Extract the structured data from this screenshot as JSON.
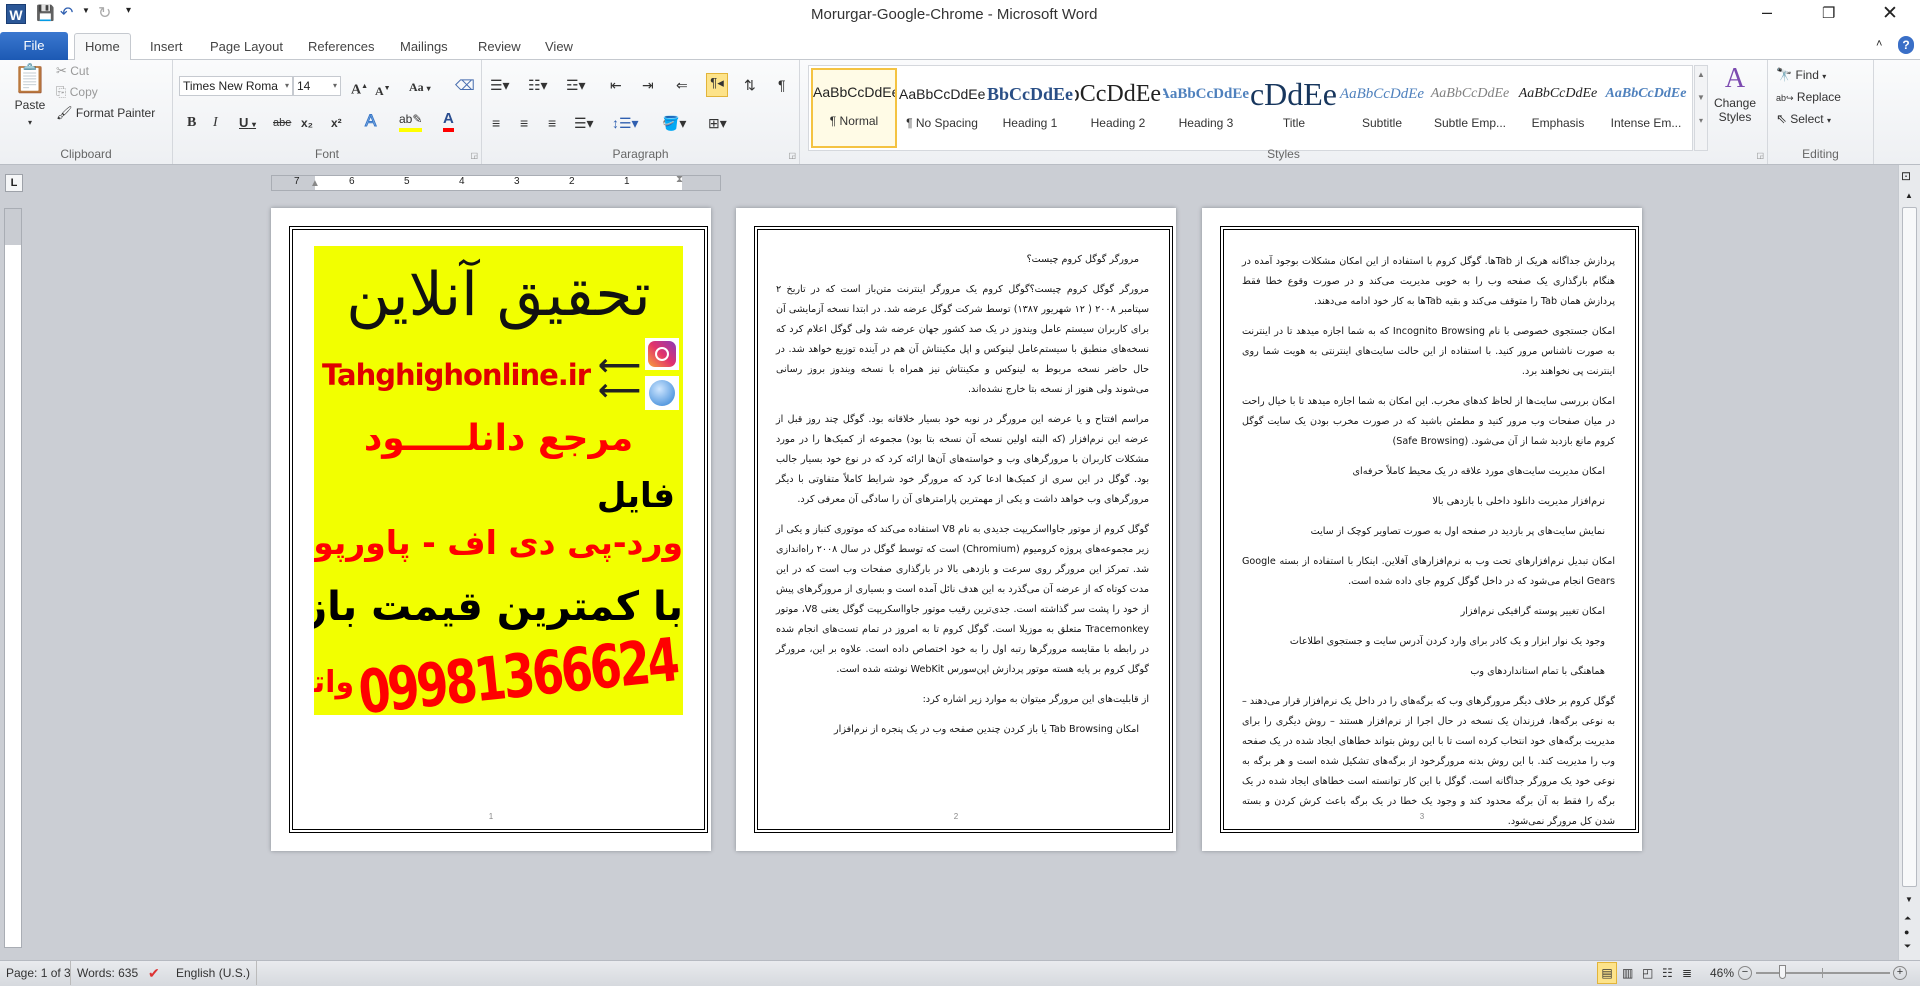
{
  "window": {
    "title": "Morurgar-Google-Chrome  -  Microsoft Word"
  },
  "qat": {
    "icons": [
      "word-logo",
      "save",
      "undo",
      "redo",
      "customize"
    ]
  },
  "tabs": {
    "file": "File",
    "items": [
      "Home",
      "Insert",
      "Page Layout",
      "References",
      "Mailings",
      "Review",
      "View"
    ],
    "selected": "Home"
  },
  "clipboard": {
    "label": "Clipboard",
    "paste": "Paste",
    "cut": "Cut",
    "copy": "Copy",
    "format_painter": "Format Painter"
  },
  "font": {
    "label": "Font",
    "name": "Times New Roma",
    "size": "14",
    "bold": "B",
    "italic": "I",
    "underline": "U",
    "strike": "abe",
    "sub": "x₂",
    "sup": "x²",
    "change_case": "Aa",
    "highlight_color": "#ffff00",
    "font_color": "#ff0000"
  },
  "paragraph": {
    "label": "Paragraph",
    "pilcrow": "¶"
  },
  "styles": {
    "label": "Styles",
    "items": [
      {
        "preview": "AaBbCcDdEe",
        "name": "¶ Normal"
      },
      {
        "preview": "AaBbCcDdEe",
        "name": "¶ No Spacing"
      },
      {
        "preview": "AaBbCcDdEe",
        "name": "Heading 1"
      },
      {
        "preview": "AaBbCcDdEe",
        "name": "Heading 2"
      },
      {
        "preview": "AaBbCcDdEe",
        "name": "Heading 3"
      },
      {
        "preview": "AaBbCcDdEe",
        "name": "Title"
      },
      {
        "preview": "AaBbCcDdEe",
        "name": "Subtitle"
      },
      {
        "preview": "AaBbCcDdEe",
        "name": "Subtle Emp..."
      },
      {
        "preview": "AaBbCcDdEe",
        "name": "Emphasis"
      },
      {
        "preview": "AaBbCcDdEe",
        "name": "Intense Em..."
      }
    ],
    "selected": "¶ Normal",
    "change_styles": "Change Styles"
  },
  "editing": {
    "label": "Editing",
    "find": "Find",
    "replace": "Replace",
    "select": "Select"
  },
  "ruler": {
    "labels": [
      "7",
      "6",
      "5",
      "4",
      "3",
      "2",
      "1"
    ]
  },
  "pages": [
    {
      "number": "1",
      "ad": {
        "title": "تحقیق آنلاین",
        "url": "Tahghighonline.ir",
        "line1": "مرجع دانلـــــود",
        "line2": "فایل",
        "line3": "ورد-پی دی اف - پاورپوینت",
        "line4": "با کمترین قیمت بازار",
        "phone": "09981366624",
        "whatsapp": "واتساپ",
        "background": "#f2ff00"
      }
    },
    {
      "number": "2",
      "paragraphs": [
        "مرورگر گوگل کروم چیست؟",
        "مرورگر گوگل کروم چیست؟گوگل کروم یک مرورگر اینترنت متن‌باز است که در تاریخ ۲ سپتامبر ۲۰۰۸ ( ۱۲ شهریور ۱۳۸۷) توسط شرکت گوگل عرضه شد. در ابتدا نسخه آزمایشی آن برای کاربران سیستم عامل ویندوز در یک صد کشور جهان عرضه شد ولی گوگل اعلام کرد که نسخه‌های منطبق با سیستم‌عامل لینوکس و اپل مکینتاش آن هم در آینده توزیع خواهد شد. در حال حاضر نسخه مربوط به لینوکس و مکینتاش نیز همراه با نسخه ویندوز بروز رسانی می‌شوند ولی هنوز از نسخه بتا خارج نشده‌اند.",
        "مراسم افتتاح و یا عرضه این مرورگر در نوبه خود بسیار خلاقانه بود. گوگل چند روز قبل از عرضه این نرم‌افزار (که البته اولین نسخه آن نسخه بتا بود) مجموعه از کمیک‌ها را در مورد مشکلات کاربران با مرورگرهای وب و خواسته‌های آن‌ها ارائه کرد که در نوع خود بسیار جالب بود. گوگل در این سری از کمیک‌ها ادعا کرد که مرورگر خود شرایط کاملاً متفاوتی با دیگر مرورگرهای وب خواهد داشت و یکی از مهمترین پارامترهای آن را سادگی آن معرفی کرد.",
        "گوگل کروم از موتور جاوااسکریپت جدیدی به نام V8 استفاده می‌کند که موتوری کنباز و یکی از زیر مجموعه‌های پروژه کرومیوم (Chromium) است که توسط گوگل در سال ۲۰۰۸ راه‌اندازی شد. تمرکز این مرورگر روی سرعت و بازدهی بالا در بارگذاری صفحات وب است که در این مدت کوتاه که از عرضه آن می‌گذرد به این هدف نائل آمده است و بسیاری از مرورگرهای پیش از خود را پشت سر گذاشته است. جدی‌ترین رقیب موتور جاوااسکریپت گوگل یعنی V8، موتور Tracemonkey متعلق به موزیلا است. گوگل کروم تا به امروز در تمام تست‌های انجام شده در رابطه با مقایسه مرورگرها رتبه اول را به خود اختصاص داده است. علاوه بر این، مرورگر گوگل کروم بر پایه هسته موتور پردازش اپن‌سورس WebKit نوشته شده است.",
        "از قابلیت‌های این مرورگر میتوان به موارد زیر اشاره کرد:",
        "امکان Tab Browsing یا باز کردن چندین صفحه وب در یک پنجره از نرم‌افزار"
      ]
    },
    {
      "number": "3",
      "paragraphs": [
        "پردازش جداگانه هریک از Tabها. گوگل کروم با استفاده از این امکان مشکلات بوجود آمده در هنگام بارگذاری یک صفحه وب را به خوبی مدیریت می‌کند و در صورت وقوع خطا فقط پردازش همان Tab را متوقف می‌کند و بقیه Tabها به کار خود ادامه می‌دهند.",
        "امکان جستجوی خصوصی با نام Incognito Browsing که به شما اجازه میدهد تا در اینترنت به صورت ناشناس مرور کنید. با استفاده از این حالت سایت‌های اینترنتی به هویت شما روی اینترنت پی نخواهند برد.",
        "امکان بررسی سایت‌ها از لحاظ کدهای مخرب. این امکان به شما اجازه میدهد تا با خیال راحت در میان صفحات وب مرور کنید و مطمئن باشید که در صورت مخرب بودن یک سایت گوگل کروم مانع بازدید شما از آن می‌شود. (Safe Browsing)",
        "امکان مدیریت سایت‌های مورد علاقه در یک محیط کاملاً حرفه‌ای",
        "نرم‌افزار مدیریت دانلود داخلی با بازدهی بالا",
        "نمایش سایت‌های پر بازدید در صفحه اول به صورت تصاویر کوچک از سایت",
        "امکان تبدیل نرم‌افزارهای تحت وب به نرم‌افزارهای آفلاین. اینکار با استفاده از بسته Google Gears انجام می‌شود که در داخل گوگل کروم جای داده شده است.",
        "امکان تغییر پوسته گرافیکی نرم‌افزار",
        "وجود یک نوار ابزار و یک کادر برای وارد کردن آدرس سایت و جستجوی اطلاعات",
        "هماهنگی با تمام استانداردهای وب",
        "گوگل کروم بر خلاف دیگر مرورگرهای وب که برگه‌های را در داخل یک نرم‌افزار قرار می‌دهند –به نوعی برگه‌ها، فرزندان یک نسخه در حال اجرا از نرم‌افزار هستند – روش دیگری را برای مدیریت برگه‌های خود انتخاب کرده است تا با این روش بتواند خطاهای ایجاد شده در یک صفحه وب را مدیریت کند. با این روش بدنه مرورگرخود از برگه‌های تشکیل شده است و هر برگه به نوعی خود یک مرورگر جداگانه است. گوگل با این کار توانسته است خطاهای ایجاد شده در یک برگه را فقط به آن برگه محدود کند و وجود یک خطا در یک برگه باعث کرش کردن و بسته شدن کل مرورگر نمی‌شود."
      ]
    }
  ],
  "status": {
    "page": "Page: 1 of 3",
    "words": "Words: 635",
    "language": "English (U.S.)",
    "zoom": "46%",
    "zoom_percent": 46
  }
}
